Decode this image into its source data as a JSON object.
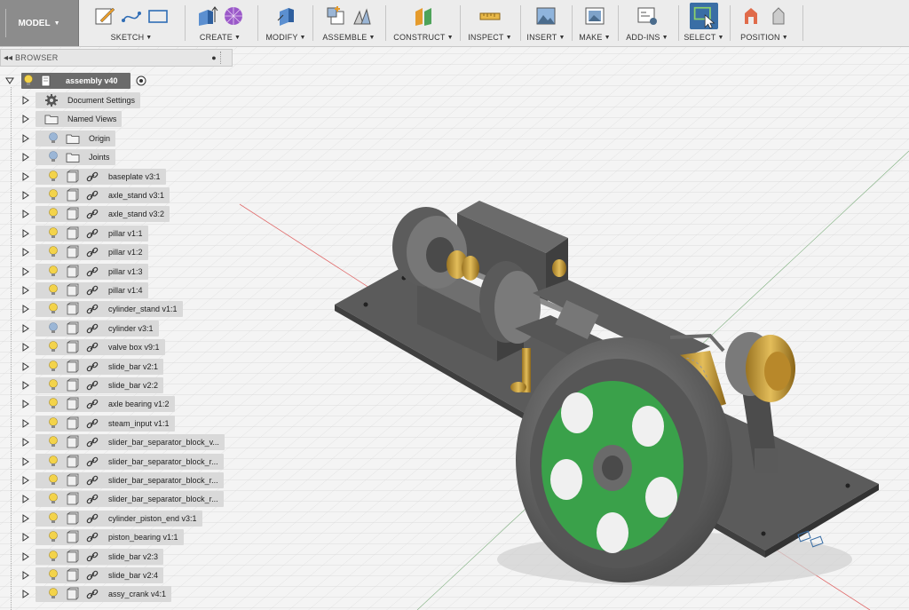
{
  "workspace": {
    "label": "MODEL"
  },
  "toolbar": {
    "groups": [
      {
        "label": "SKETCH"
      },
      {
        "label": "CREATE"
      },
      {
        "label": "MODIFY"
      },
      {
        "label": "ASSEMBLE"
      },
      {
        "label": "CONSTRUCT"
      },
      {
        "label": "INSPECT"
      },
      {
        "label": "INSERT"
      },
      {
        "label": "MAKE"
      },
      {
        "label": "ADD-INS"
      },
      {
        "label": "SELECT"
      },
      {
        "label": "POSITION"
      }
    ],
    "active_group": "SELECT"
  },
  "browser": {
    "title": "BROWSER",
    "collapse_glyph": "◂◂",
    "minimize_glyph": "●",
    "root": {
      "label": "assembly v40"
    },
    "items": [
      {
        "label": "Document Settings",
        "icon": "gear-icon"
      },
      {
        "label": "Named Views",
        "icon": "folder-icon"
      },
      {
        "label": "Origin",
        "icon": "folder-icon",
        "bulb": "off"
      },
      {
        "label": "Joints",
        "icon": "folder-icon",
        "bulb": "off"
      },
      {
        "label": "baseplate v3:1",
        "icon": "component-icon"
      },
      {
        "label": "axle_stand v3:1",
        "icon": "component-icon"
      },
      {
        "label": "axle_stand v3:2",
        "icon": "component-icon"
      },
      {
        "label": "pillar v1:1",
        "icon": "component-icon"
      },
      {
        "label": "pillar v1:2",
        "icon": "component-icon"
      },
      {
        "label": "pillar v1:3",
        "icon": "component-icon"
      },
      {
        "label": "pillar v1:4",
        "icon": "component-icon"
      },
      {
        "label": "cylinder_stand v1:1",
        "icon": "component-icon"
      },
      {
        "label": "cylinder v3:1",
        "icon": "component-icon",
        "bulb": "off"
      },
      {
        "label": "valve box v9:1",
        "icon": "component-icon"
      },
      {
        "label": "slide_bar v2:1",
        "icon": "component-icon"
      },
      {
        "label": "slide_bar v2:2",
        "icon": "component-icon"
      },
      {
        "label": "axle bearing v1:2",
        "icon": "component-icon"
      },
      {
        "label": "steam_input v1:1",
        "icon": "component-icon"
      },
      {
        "label": "slider_bar_separator_block_v...",
        "icon": "component-icon"
      },
      {
        "label": "slider_bar_separator_block_r...",
        "icon": "component-icon"
      },
      {
        "label": "slider_bar_separator_block_r...",
        "icon": "component-icon"
      },
      {
        "label": "slider_bar_separator_block_r...",
        "icon": "component-icon"
      },
      {
        "label": "cylinder_piston_end v3:1",
        "icon": "component-icon"
      },
      {
        "label": "piston_bearing v1:1",
        "icon": "component-icon"
      },
      {
        "label": "slide_bar v2:3",
        "icon": "component-icon"
      },
      {
        "label": "slide_bar v2:4",
        "icon": "component-icon"
      },
      {
        "label": "assy_crank v4:1",
        "icon": "component-icon"
      }
    ]
  },
  "colors": {
    "bulb_on": "#f3d34a",
    "bulb_off": "#9bb6d6",
    "select_active": "#3a6ea5",
    "flywheel_spokes": "#3aa14a",
    "brass": "#c79a35",
    "steel": "#6d6d6d"
  }
}
